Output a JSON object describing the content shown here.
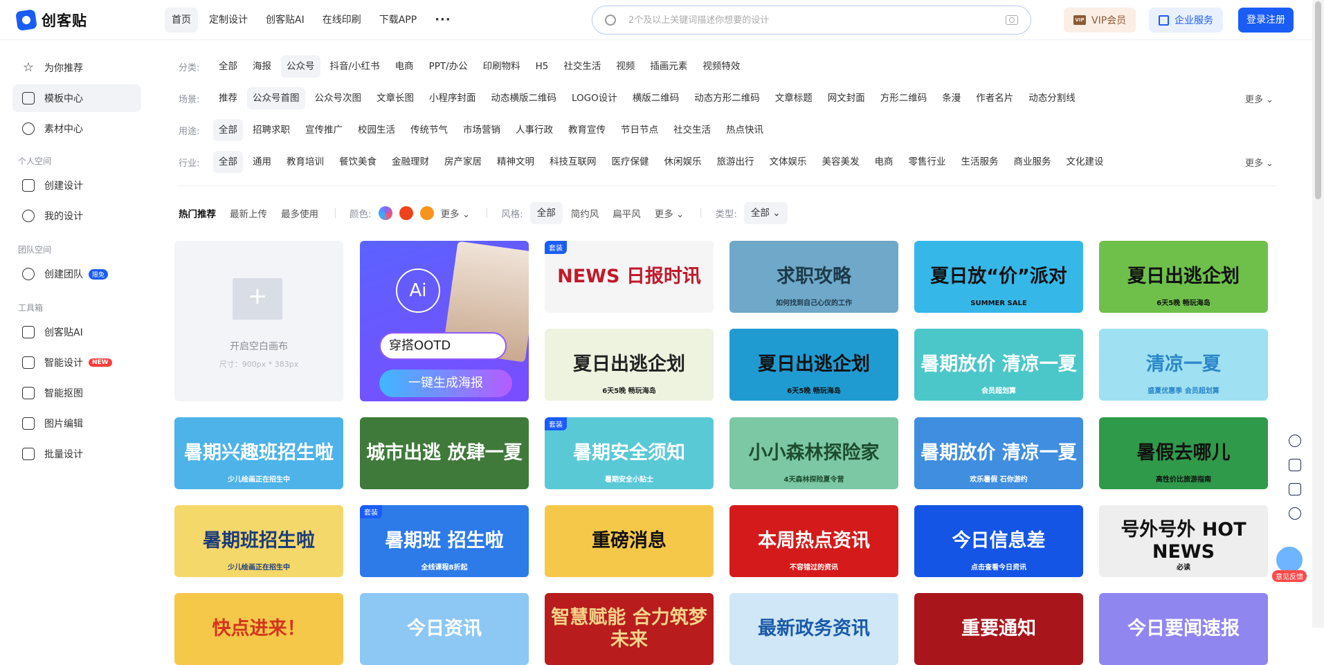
{
  "brand": {
    "name": "创客贴"
  },
  "nav": {
    "items": [
      "首页",
      "定制设计",
      "创客贴AI",
      "在线印刷",
      "下载APP"
    ],
    "more": "···"
  },
  "search": {
    "placeholder": "2个及以上关键词描述你想要的设计"
  },
  "header": {
    "vip": "VIP会员",
    "vip_icon": "VIP",
    "enterprise": "企业服务",
    "login": "登录注册"
  },
  "sidebar": {
    "main": [
      "为你推荐",
      "模板中心",
      "素材中心"
    ],
    "personal_title": "个人空间",
    "personal": [
      "创建设计",
      "我的设计"
    ],
    "team_title": "团队空间",
    "team": "创建团队",
    "team_badge": "限免",
    "tools_title": "工具箱",
    "tools": [
      "创客贴AI",
      "智能设计",
      "智能抠图",
      "图片编辑",
      "批量设计"
    ],
    "tools_badge": "NEW"
  },
  "filters": {
    "more": "更多",
    "category": {
      "label": "分类:",
      "items": [
        "全部",
        "海报",
        "公众号",
        "抖音/小红书",
        "电商",
        "PPT/办公",
        "印刷物料",
        "H5",
        "社交生活",
        "视频",
        "插画元素",
        "视频特效"
      ]
    },
    "scene": {
      "label": "场景:",
      "items": [
        "推荐",
        "公众号首图",
        "公众号次图",
        "文章长图",
        "小程序封面",
        "动态横版二维码",
        "LOGO设计",
        "横版二维码",
        "动态方形二维码",
        "文章标题",
        "网文封面",
        "方形二维码",
        "条漫",
        "作者名片",
        "动态分割线"
      ]
    },
    "purpose": {
      "label": "用途:",
      "items": [
        "全部",
        "招聘求职",
        "宣传推广",
        "校园生活",
        "传统节气",
        "市场营销",
        "人事行政",
        "教育宣传",
        "节日节点",
        "社交生活",
        "热点快讯"
      ]
    },
    "industry": {
      "label": "行业:",
      "items": [
        "全部",
        "通用",
        "教育培训",
        "餐饮美食",
        "金融理财",
        "房产家居",
        "精神文明",
        "科技互联网",
        "医疗保健",
        "休闲娱乐",
        "旅游出行",
        "文体娱乐",
        "美容美发",
        "电商",
        "零售行业",
        "生活服务",
        "商业服务",
        "文化建设"
      ]
    }
  },
  "sortbar": {
    "sorts": [
      "热门推荐",
      "最新上传",
      "最多使用"
    ],
    "color_label": "颜色:",
    "colors": [
      "#7b6cff",
      "#f0421c",
      "#f7941d"
    ],
    "more": "更多",
    "style_label": "风格:",
    "styles": [
      "全部",
      "简约风",
      "扁平风"
    ],
    "type_label": "类型:",
    "type_value": "全部"
  },
  "blank_canvas": {
    "title": "开启空白画布",
    "size": "尺寸：900px * 383px"
  },
  "ai_card": {
    "logo": "Ai",
    "input": "穿搭OOTD",
    "button": "一键生成海报"
  },
  "suit_tag": "套装",
  "templates": [
    {
      "title": "NEWS 日报时讯",
      "suit": true,
      "bg": "#f5f5f5",
      "color": "#c0192a",
      "sub": ""
    },
    {
      "title": "求职攻略",
      "suit": false,
      "bg": "#6fa8c8",
      "color": "#1d3a4a",
      "sub": "如何找到自己心仪的工作"
    },
    {
      "title": "夏日放“价”派对",
      "suit": false,
      "bg": "#35b8e8",
      "color": "#111111",
      "sub": "SUMMER SALE"
    },
    {
      "title": "夏日出逃企划",
      "suit": false,
      "bg": "#6ec04a",
      "color": "#111111",
      "sub": "6天5晚 畅玩海岛"
    },
    {
      "title": "夏日出逃企划",
      "suit": false,
      "bg": "#eef3e0",
      "color": "#222222",
      "sub": "6天5晚 畅玩海岛"
    },
    {
      "title": "夏日出逃企划",
      "suit": false,
      "bg": "#1f9bd1",
      "color": "#111111",
      "sub": "6天5晚 畅玩海岛"
    },
    {
      "title": "暑期放价 清凉一夏",
      "suit": false,
      "bg": "#4cc7c9",
      "color": "#ffffff",
      "sub": "会员超划算"
    },
    {
      "title": "清凉一夏",
      "suit": false,
      "bg": "#9fe0f2",
      "color": "#2a86c8",
      "sub": "盛夏优惠季 会员超划算"
    },
    {
      "title": "暑期兴趣班招生啦",
      "suit": false,
      "bg": "#4db3e8",
      "color": "#ffffff",
      "sub": "少儿绘画正在招生中"
    },
    {
      "title": "城市出逃 放肆一夏",
      "suit": false,
      "bg": "#3f7a3a",
      "color": "#ffffff",
      "sub": ""
    },
    {
      "title": "暑期安全须知",
      "suit": true,
      "bg": "#5ac9d6",
      "color": "#ffffff",
      "sub": "暑期安全小贴士"
    },
    {
      "title": "小小森林探险家",
      "suit": false,
      "bg": "#7cc8a4",
      "color": "#1d4d2e",
      "sub": "4天森林探险夏令营"
    },
    {
      "title": "暑期放价 清凉一夏",
      "suit": false,
      "bg": "#3f8ee0",
      "color": "#ffffff",
      "sub": "欢乐暑假 石你游约"
    },
    {
      "title": "暑假去哪儿",
      "suit": false,
      "bg": "#2f9a4a",
      "color": "#111111",
      "sub": "高性价比旅游指南"
    },
    {
      "title": "暑期班招生啦",
      "suit": false,
      "bg": "#f5d86a",
      "color": "#1b3c7a",
      "sub": "少儿绘画正在招生中"
    },
    {
      "title": "暑期班 招生啦",
      "suit": true,
      "bg": "#2d7be8",
      "color": "#ffffff",
      "sub": "全线课程8折起"
    },
    {
      "title": "重磅消息",
      "suit": false,
      "bg": "#f6c84a",
      "color": "#111111",
      "sub": ""
    },
    {
      "title": "本周热点资讯",
      "suit": false,
      "bg": "#d41a1a",
      "color": "#ffffff",
      "sub": "不容错过的资讯"
    },
    {
      "title": "今日信息差",
      "suit": false,
      "bg": "#1455e6",
      "color": "#ffffff",
      "sub": "点击查看今日资讯"
    },
    {
      "title": "号外号外 HOT NEWS",
      "suit": false,
      "bg": "#eeeeee",
      "color": "#111111",
      "sub": "必读"
    },
    {
      "title": "快点进来！",
      "suit": false,
      "bg": "#f6c84a",
      "color": "#d4351c",
      "sub": ""
    },
    {
      "title": "今日资讯",
      "suit": false,
      "bg": "#8dc8f5",
      "color": "#ffffff",
      "sub": ""
    },
    {
      "title": "智慧赋能 合力筑梦未来",
      "suit": false,
      "bg": "#b81c1c",
      "color": "#f6d48a",
      "sub": ""
    },
    {
      "title": "最新政务资讯",
      "suit": false,
      "bg": "#cfe7f7",
      "color": "#1a5aa8",
      "sub": ""
    },
    {
      "title": "重要通知",
      "suit": false,
      "bg": "#a8161b",
      "color": "#ffffff",
      "sub": ""
    },
    {
      "title": "今日要闻速报",
      "suit": false,
      "bg": "#8f86f0",
      "color": "#ffffff",
      "sub": ""
    }
  ],
  "feedback": {
    "label": "意见反馈"
  }
}
